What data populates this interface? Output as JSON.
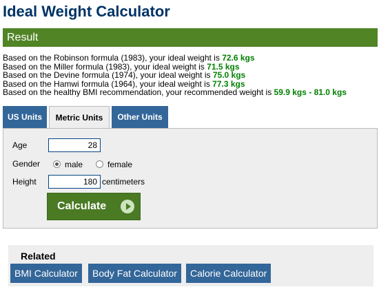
{
  "page": {
    "title": "Ideal Weight Calculator"
  },
  "result": {
    "header": "Result",
    "lines": [
      {
        "prefix": "Based on the Robinson formula (1983), your ideal weight is ",
        "value": "72.6 kgs"
      },
      {
        "prefix": "Based on the Miller formula (1983), your ideal weight is ",
        "value": "71.5 kgs"
      },
      {
        "prefix": "Based on the Devine formula (1974), your ideal weight is ",
        "value": "75.0 kgs"
      },
      {
        "prefix": "Based on the Hamwi formula (1964), your ideal weight is ",
        "value": "77.3 kgs"
      },
      {
        "prefix": "Based on the healthy BMI recommendation, your recommended weight is ",
        "value": "59.9 kgs - 81.0 kgs"
      }
    ]
  },
  "tabs": [
    {
      "label": "US Units",
      "active": false
    },
    {
      "label": "Metric Units",
      "active": true
    },
    {
      "label": "Other Units",
      "active": false
    }
  ],
  "form": {
    "age_label": "Age",
    "age_value": "28",
    "gender_label": "Gender",
    "gender_options": [
      {
        "label": "male",
        "checked": true
      },
      {
        "label": "female",
        "checked": false
      }
    ],
    "height_label": "Height",
    "height_value": "180",
    "height_unit": "centimeters",
    "calculate_label": "Calculate"
  },
  "related": {
    "title": "Related",
    "links": [
      "BMI Calculator",
      "Body Fat Calculator",
      "Calorie Calculator"
    ]
  },
  "colors": {
    "title": "#003366",
    "result_header_bg": "#518425",
    "result_value": "#008000",
    "tab_bg": "#336699",
    "button_green": "#4a7a24",
    "panel_bg": "#eeeeee"
  }
}
